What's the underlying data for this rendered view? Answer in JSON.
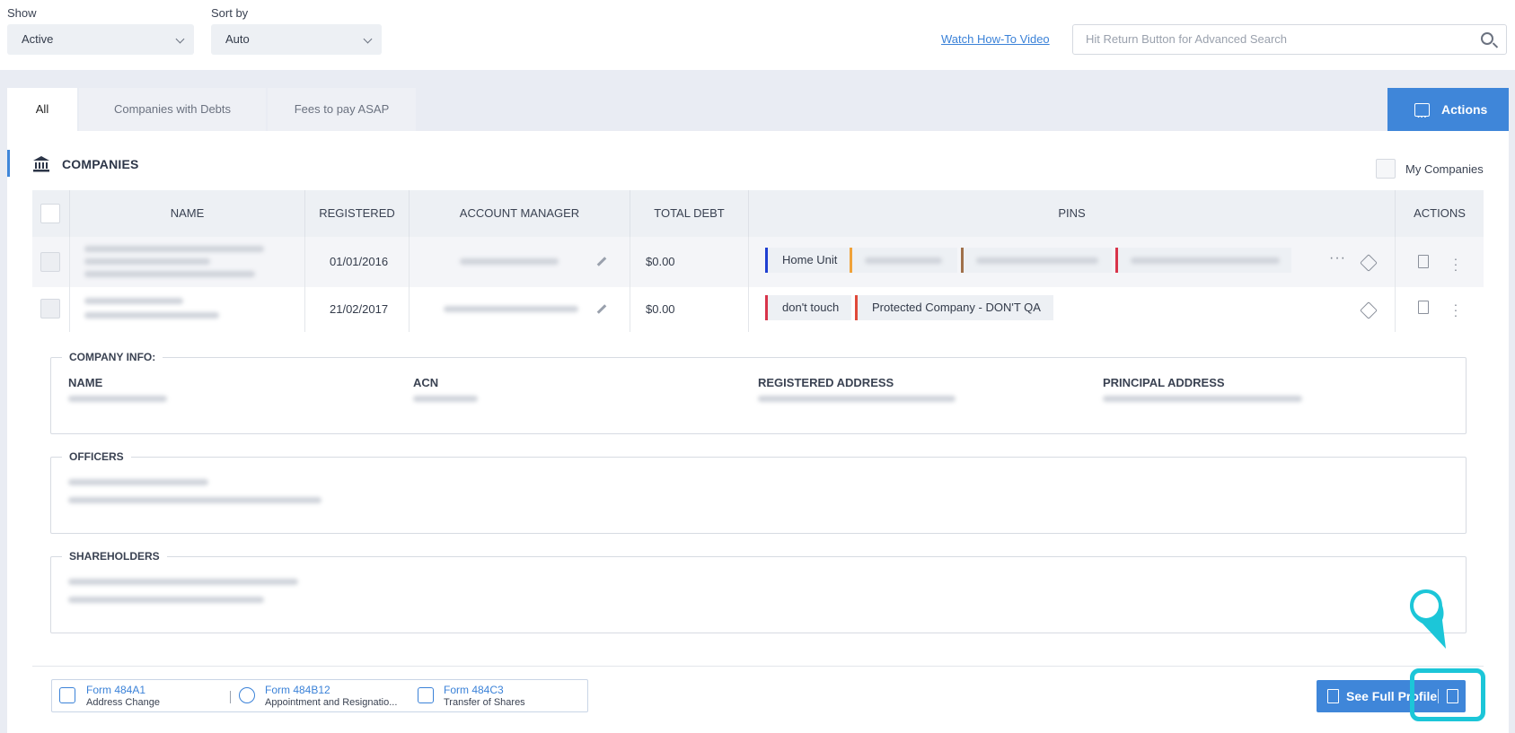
{
  "filters": {
    "show_label": "Show",
    "show_value": "Active",
    "sort_label": "Sort by",
    "sort_value": "Auto"
  },
  "header": {
    "howto_link": "Watch How-To Video",
    "search_placeholder": "Hit Return Button for Advanced Search"
  },
  "tabs": [
    {
      "label": "All",
      "active": true
    },
    {
      "label": "Companies with Debts",
      "active": false
    },
    {
      "label": "Fees to pay ASAP",
      "active": false
    }
  ],
  "actions_button": "Actions",
  "section": {
    "title": "COMPANIES",
    "my_companies": "My Companies"
  },
  "table": {
    "columns": [
      "NAME",
      "REGISTERED",
      "ACCOUNT MANAGER",
      "TOTAL DEBT",
      "PINS",
      "ACTIONS"
    ],
    "rows": [
      {
        "registered": "01/01/2016",
        "total_debt": "$0.00",
        "pins": [
          "Home Unit"
        ]
      },
      {
        "registered": "21/02/2017",
        "total_debt": "$0.00",
        "pins": [
          "don't touch",
          "Protected Company - DON'T QA"
        ]
      }
    ]
  },
  "detail": {
    "company_info_legend": "COMPANY INFO:",
    "columns": [
      "NAME",
      "ACN",
      "REGISTERED ADDRESS",
      "PRINCIPAL ADDRESS"
    ],
    "officers_legend": "OFFICERS",
    "shareholders_legend": "SHAREHOLDERS"
  },
  "forms": [
    {
      "title": "Form 484A1",
      "desc": "Address Change"
    },
    {
      "title": "Form 484B12",
      "desc": "Appointment and Resignatio..."
    },
    {
      "title": "Form 484C3",
      "desc": "Transfer of Shares"
    }
  ],
  "full_profile_button": "See Full Profile",
  "colors": {
    "accent": "#3f86d9",
    "highlight": "#1cc6d8",
    "pin_blue": "#1f3fd1",
    "pin_orange": "#f0a23a",
    "pin_brown": "#a0704a",
    "pin_red": "#d8344a"
  }
}
